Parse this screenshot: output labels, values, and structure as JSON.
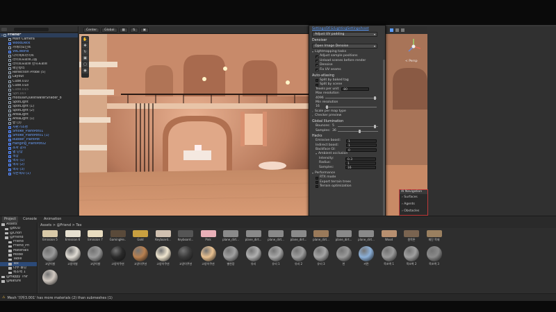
{
  "scene_toolbar": {
    "shading": "Center",
    "space": "Global"
  },
  "hierarchy": {
    "rows": [
      {
        "label": "Friend*",
        "style": "friend",
        "depth": 0
      },
      {
        "label": "Main Camera",
        "style": "normal",
        "depth": 1
      },
      {
        "label": "WoodDeck",
        "style": "blue",
        "depth": 1
      },
      {
        "label": "카메라포인트",
        "style": "normal",
        "depth": 1
      },
      {
        "label": "VRCWorld",
        "style": "blue",
        "depth": 1
      },
      {
        "label": "다이렉트라이트",
        "style": "normal",
        "depth": 1
      },
      {
        "label": "라이트프로브그룹",
        "style": "normal",
        "depth": 1
      },
      {
        "label": "라이트프로브 반사프로브",
        "style": "normal",
        "depth": 1
      },
      {
        "label": "메인방리",
        "style": "normal",
        "depth": 1
      },
      {
        "label": "Reflection Probe (5)",
        "style": "normal",
        "depth": 1
      },
      {
        "label": "Layout",
        "style": "normal",
        "depth": 1
      },
      {
        "label": "Cube.010",
        "style": "normal",
        "depth": 1
      },
      {
        "label": "Cube.018",
        "style": "normal",
        "depth": 1
      },
      {
        "label": "Cube.015",
        "style": "dim",
        "depth": 1
      },
      {
        "label": "Sph.007",
        "style": "dim",
        "depth": 1
      },
      {
        "label": "modularQuestWaterShader_8",
        "style": "normal",
        "depth": 1
      },
      {
        "label": "SpotLight",
        "style": "normal",
        "depth": 1
      },
      {
        "label": "SpotLight (1)",
        "style": "normal",
        "depth": 1
      },
      {
        "label": "SpotLight (2)",
        "style": "normal",
        "depth": 1
      },
      {
        "label": "AreaLight",
        "style": "normal",
        "depth": 1
      },
      {
        "label": "AreaLight (1)",
        "style": "normal",
        "depth": 1
      },
      {
        "label": "방 (3)",
        "style": "normal",
        "depth": 1
      },
      {
        "label": "자판기조명",
        "style": "blue",
        "depth": 1
      },
      {
        "label": "Smoke_PlantPot01",
        "style": "blue",
        "depth": 1
      },
      {
        "label": "Smoke_PlantPot01 (1)",
        "style": "blue",
        "depth": 1
      },
      {
        "label": "Rubber_PlantPot",
        "style": "blue",
        "depth": 1
      },
      {
        "label": "Hanging_PlantPot02",
        "style": "blue",
        "depth": 1
      },
      {
        "label": "소파 감자",
        "style": "blue",
        "depth": 1
      },
      {
        "label": "별 단장",
        "style": "blue",
        "depth": 1
      },
      {
        "label": "책장",
        "style": "blue",
        "depth": 1
      },
      {
        "label": "액자 (1)",
        "style": "blue",
        "depth": 1
      },
      {
        "label": "액자 (2)",
        "style": "blue",
        "depth": 1
      },
      {
        "label": "액자 (3)",
        "style": "blue",
        "depth": 1
      },
      {
        "label": "작은액자 (1)",
        "style": "blue",
        "depth": 1
      }
    ]
  },
  "popup": {
    "link": "Settings/DFG/LightingSettingsAsset",
    "padding_dd": "Adjust UV padding",
    "denoiser_label": "Denoiser",
    "denoiser_dd": "Open Image Denoise",
    "tasks_label": "Lightmapping tasks",
    "tasks": [
      "Adjust sample positions",
      "Unload scenes before render",
      "Denoise",
      "Fix UV seams"
    ],
    "aa_label": "Auto-atlasing",
    "aa_rows": [
      "Split by baked tag",
      "Split by scene"
    ],
    "texels_label": "Texels per unit",
    "texels_value": "80",
    "maxres_label": "Max resolution",
    "maxres_value": "4096",
    "maxres_level": 0.98,
    "minres_label": "Min resolution",
    "minres_value": "16",
    "minres_level": 0.02,
    "scale_label": "Scale per map type",
    "checker_label": "Checker preview",
    "gi_label": "Global Illumination",
    "bounces_label": "Bounces:",
    "bounces_value": "5",
    "bounces_level": 0.95,
    "samples_label": "Samples:",
    "samples_value": "36",
    "samples_level": 0.55,
    "hacks_label": "Hacks",
    "emissive_label": "Emissive boost:",
    "emissive_value": "1",
    "indirect_label": "Indirect boost:",
    "indirect_value": "1",
    "backface_label": "Backface GI:",
    "backface_value": "0",
    "ao_label": "Ambient occlusion",
    "intensity_label": "Intensity:",
    "intensity_value": "0.3",
    "radius_label": "Radius:",
    "radius_value": "1",
    "ao_samples_label": "Samples:",
    "ao_samples_value": "16",
    "perf_label": "Performance",
    "perf_rows": [
      "RTX mode",
      "Export terrain trees",
      "Terrain optimization"
    ]
  },
  "ai_panel": {
    "title": "AI Navigation",
    "items": [
      "Surfaces",
      "Agents",
      "Obstacles"
    ]
  },
  "scene_gizmo": {
    "label": "< Persp"
  },
  "bottom_tabs": [
    "Project",
    "Console",
    "Animation"
  ],
  "project": {
    "breadcrumb": "Assets > @Friend > Tex",
    "tree": [
      {
        "label": "Assets",
        "sel": false
      },
      {
        "label": "@BUD",
        "sel": false
      },
      {
        "label": "@Chori",
        "sel": false
      },
      {
        "label": "@Friend",
        "sel": false
      },
      {
        "label": "Friend",
        "sel": false
      },
      {
        "label": "Friend_Pri",
        "sel": false
      },
      {
        "label": "Materials",
        "sel": false
      },
      {
        "label": "Model",
        "sel": false
      },
      {
        "label": "Table",
        "sel": false
      },
      {
        "label": "Tex",
        "sel": true
      },
      {
        "label": "나무 몰딩",
        "sel": false
      },
      {
        "label": "목조벽 1",
        "sel": false
      },
      {
        "label": "@Happy Thir",
        "sel": false
      },
      {
        "label": "@Nature",
        "sel": false
      }
    ],
    "row1": [
      {
        "label": "Emission 5",
        "color": "#d8c9a8"
      },
      {
        "label": "Emission 6",
        "color": "#e6e0d0"
      },
      {
        "label": "Emission 7",
        "color": "#e8dcc0"
      },
      {
        "label": "GamingHe..",
        "color": "#5a4a3a"
      },
      {
        "label": "Gold",
        "color": "#c9a040"
      },
      {
        "label": "Keyboard...",
        "color": "#d0c0b0"
      },
      {
        "label": "Keyboard...",
        "color": "#555555"
      },
      {
        "label": "Pink",
        "color": "#e8b0b8"
      },
      {
        "label": "plane_dirt...",
        "color": "#8a8a8a"
      },
      {
        "label": "plane_dirt...",
        "color": "#8a8a8a"
      },
      {
        "label": "plane_dirt...",
        "color": "#8a8a8a"
      },
      {
        "label": "plane_dirt...",
        "color": "#8a8a8a"
      },
      {
        "label": "plane_dirt...",
        "color": "#9a7a5a"
      },
      {
        "label": "plane_dirt...",
        "color": "#8a8a8a"
      },
      {
        "label": "plane_dirt...",
        "color": "#8a8a8a"
      },
      {
        "label": "Wood",
        "color": "#b89070"
      },
      {
        "label": "원목톤",
        "color": "#7a6450"
      },
      {
        "label": "재단 목재",
        "color": "#9a8060"
      }
    ],
    "row2": [
      {
        "label": "고양이발",
        "color": "#9a9a9a"
      },
      {
        "label": "고양이발",
        "color": "#e0dcd4"
      },
      {
        "label": "고양이발",
        "color": "#9a9a9a"
      },
      {
        "label": "고양이쿠션",
        "color": "#2a2a2a"
      },
      {
        "label": "고양이쿠션",
        "color": "#b88050"
      },
      {
        "label": "고양이쿠션",
        "color": "#f0e6d0"
      },
      {
        "label": "고양이쿠션",
        "color": "#3a3a3a"
      },
      {
        "label": "고양이쿠션",
        "color": "#e8c090"
      },
      {
        "label": "별천장",
        "color": "#a0a0a0"
      },
      {
        "label": "유리",
        "color": "#b0b0b0"
      },
      {
        "label": "유리 1",
        "color": "#a8a8a8"
      },
      {
        "label": "유리 2",
        "color": "#9e9e9e"
      },
      {
        "label": "유리 3",
        "color": "#a4a4a4"
      },
      {
        "label": "천",
        "color": "#9a9a9a"
      },
      {
        "label": "커튼",
        "color": "#8cb0d8"
      },
      {
        "label": "목조벽 1",
        "color": "#9a9a9a"
      },
      {
        "label": "목조벽 2",
        "color": "#a0a0a0"
      },
      {
        "label": "목조벽 3",
        "color": "#8a8a8a"
      }
    ],
    "row3": [
      {
        "label": "",
        "color": "#d0c8c0"
      }
    ]
  },
  "status": "Mesh '의자3.001' has more materials (2) than submeshes (1)"
}
